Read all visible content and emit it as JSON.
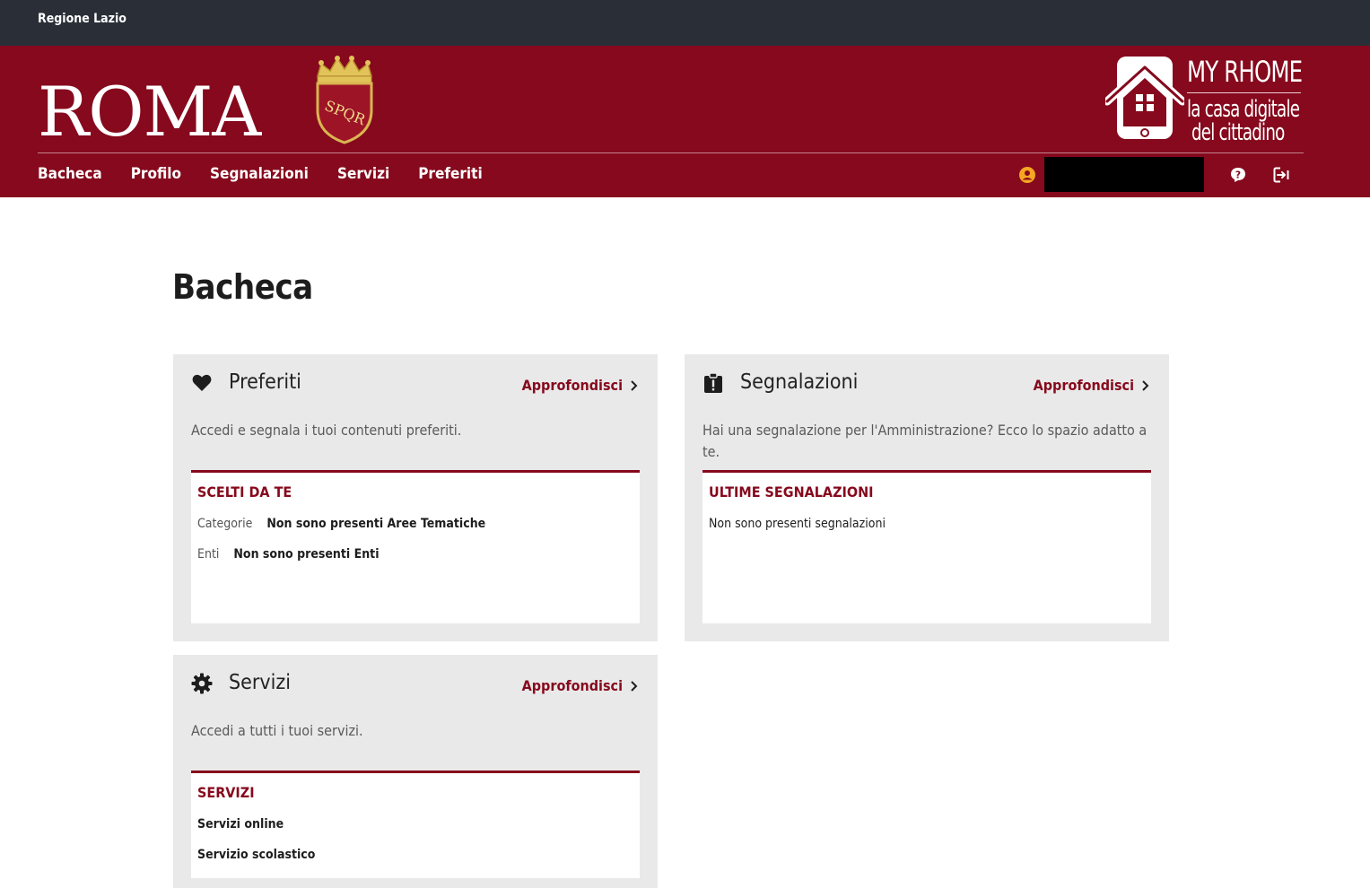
{
  "topbar": {
    "region": "Regione Lazio"
  },
  "header": {
    "roma_logo": "ROMA",
    "crest_text": "SPQR",
    "brand_title": "MY RHOME",
    "brand_sub1": "la casa digitale",
    "brand_sub2": "del cittadino"
  },
  "nav": {
    "items": [
      "Bacheca",
      "Profilo",
      "Segnalazioni",
      "Servizi",
      "Preferiti"
    ]
  },
  "user": {
    "name": ""
  },
  "page": {
    "title": "Bacheca"
  },
  "cards": {
    "preferiti": {
      "title": "Preferiti",
      "link": "Approfondisci",
      "desc": "Accedi e segnala i tuoi contenuti preferiti.",
      "inner_title": "SCELTI DA TE",
      "rows": [
        {
          "label": "Categorie",
          "value": "Non sono presenti Aree Tematiche"
        },
        {
          "label": "Enti",
          "value": "Non sono presenti Enti"
        }
      ]
    },
    "segnalazioni": {
      "title": "Segnalazioni",
      "link": "Approfondisci",
      "desc": "Hai una segnalazione per l'Amministrazione? Ecco lo spazio adatto a te.",
      "inner_title": "ULTIME SEGNALAZIONI",
      "empty": "Non sono presenti segnalazioni"
    },
    "servizi": {
      "title": "Servizi",
      "link": "Approfondisci",
      "desc": "Accedi a tutti i tuoi servizi.",
      "inner_title": "SERVIZI",
      "items": [
        "Servizi online",
        "Servizio scolastico"
      ]
    }
  },
  "icons": {
    "user": "user-circle-icon",
    "help": "help-icon",
    "logout": "logout-icon",
    "preferiti": "heart-icon",
    "segnalazioni": "clipboard-alert-icon",
    "servizi": "gear-icon",
    "chevron": "chevron-right-icon"
  },
  "colors": {
    "brand": "#86091d",
    "topbar": "#2a2f37",
    "card_bg": "#e9e9e9",
    "user_icon": "#f5a623"
  }
}
